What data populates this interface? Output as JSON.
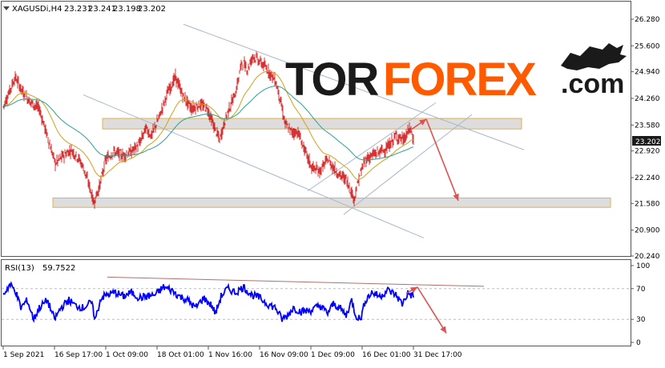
{
  "window": {
    "symbol_header": "XAGUSDi,H4",
    "ohlc": [
      "23.231",
      "23.241",
      "23.198",
      "23.202"
    ],
    "current_price": "23.202"
  },
  "watermark": {
    "part1": "TOR",
    "part2": "FOREX",
    "part3": ".com"
  },
  "colors": {
    "candle": "#cc0000",
    "ema_fast": "#d4a017",
    "ema_slow": "#2aa198",
    "rsi_line": "#0000ff",
    "arrow": "#e05050",
    "channel": "#a8b8c8",
    "zone_fill": "#dddddd",
    "zone_border": "#e8b04a",
    "logo_dark": "#1a1a1a",
    "logo_orange": "#ff5a00"
  },
  "chart_data": [
    {
      "type": "candlestick",
      "symbol": "XAGUSDi",
      "timeframe": "H4",
      "ylim": [
        20.2,
        26.4
      ],
      "y_ticks": [
        "26.280",
        "25.600",
        "24.940",
        "24.260",
        "23.580",
        "22.920",
        "22.240",
        "21.580",
        "20.900",
        "20.240"
      ],
      "y_tick_values": [
        26.28,
        25.6,
        24.94,
        24.26,
        23.58,
        22.92,
        22.24,
        21.58,
        20.9,
        20.24
      ],
      "x_ticks": [
        "1 Sep 2021",
        "16 Sep 17:00",
        "1 Oct 09:00",
        "18 Oct 01:00",
        "1 Nov 16:00",
        "16 Nov 09:00",
        "1 Dec 09:00",
        "16 Dec 01:00",
        "31 Dec 17:00"
      ],
      "x_tick_index": [
        0,
        64,
        128,
        192,
        256,
        320,
        384,
        448,
        512
      ],
      "close_path": [
        [
          0,
          24.05
        ],
        [
          8,
          24.45
        ],
        [
          15,
          24.8
        ],
        [
          25,
          24.4
        ],
        [
          35,
          24.15
        ],
        [
          45,
          24.0
        ],
        [
          55,
          23.3
        ],
        [
          65,
          22.6
        ],
        [
          75,
          22.8
        ],
        [
          85,
          22.95
        ],
        [
          95,
          22.7
        ],
        [
          100,
          22.5
        ],
        [
          108,
          22.0
        ],
        [
          113,
          21.6
        ],
        [
          120,
          22.0
        ],
        [
          128,
          22.7
        ],
        [
          138,
          22.9
        ],
        [
          150,
          22.8
        ],
        [
          160,
          22.9
        ],
        [
          170,
          23.1
        ],
        [
          178,
          23.5
        ],
        [
          185,
          23.3
        ],
        [
          195,
          23.8
        ],
        [
          205,
          24.4
        ],
        [
          215,
          24.8
        ],
        [
          225,
          24.3
        ],
        [
          235,
          24.0
        ],
        [
          245,
          24.1
        ],
        [
          255,
          24.0
        ],
        [
          262,
          23.6
        ],
        [
          270,
          23.2
        ],
        [
          280,
          23.9
        ],
        [
          290,
          24.4
        ],
        [
          298,
          25.2
        ],
        [
          305,
          25.0
        ],
        [
          312,
          25.35
        ],
        [
          320,
          25.2
        ],
        [
          330,
          25.0
        ],
        [
          340,
          24.7
        ],
        [
          345,
          24.3
        ],
        [
          352,
          23.6
        ],
        [
          360,
          23.4
        ],
        [
          368,
          23.4
        ],
        [
          375,
          23.0
        ],
        [
          385,
          22.5
        ],
        [
          395,
          22.4
        ],
        [
          405,
          22.7
        ],
        [
          412,
          22.5
        ],
        [
          420,
          22.3
        ],
        [
          428,
          22.2
        ],
        [
          433,
          21.95
        ],
        [
          438,
          21.7
        ],
        [
          445,
          22.3
        ],
        [
          452,
          22.7
        ],
        [
          460,
          22.8
        ],
        [
          470,
          22.9
        ],
        [
          480,
          23.0
        ],
        [
          490,
          23.3
        ],
        [
          500,
          23.2
        ],
        [
          508,
          23.5
        ],
        [
          512,
          23.2
        ]
      ],
      "last_price": 23.202,
      "support_zone": [
        21.48,
        21.72
      ],
      "resistance_zone": [
        23.48,
        23.75
      ],
      "forecast_arrow": {
        "from": [
          512,
          23.65
        ],
        "to": [
          548,
          21.65
        ]
      },
      "channels": [
        {
          "from": [
            225,
            26.15
          ],
          "to": [
            650,
            22.95
          ]
        },
        {
          "from": [
            100,
            24.35
          ],
          "to": [
            525,
            20.7
          ]
        },
        {
          "from": [
            380,
            21.9
          ],
          "to": [
            540,
            24.15
          ]
        },
        {
          "from": [
            425,
            21.3
          ],
          "to": [
            585,
            23.85
          ]
        }
      ]
    },
    {
      "type": "line",
      "indicator": "RSI(13)",
      "value_label": "59.7522",
      "ylim": [
        0,
        100
      ],
      "y_ticks": [
        "100",
        "70",
        "30",
        "0"
      ],
      "y_tick_values": [
        100,
        70,
        30,
        0
      ],
      "levels": [
        70,
        30
      ],
      "rsi_path": [
        [
          0,
          62
        ],
        [
          8,
          75
        ],
        [
          15,
          68
        ],
        [
          22,
          45
        ],
        [
          30,
          55
        ],
        [
          38,
          30
        ],
        [
          45,
          45
        ],
        [
          55,
          55
        ],
        [
          64,
          30
        ],
        [
          72,
          45
        ],
        [
          82,
          55
        ],
        [
          90,
          48
        ],
        [
          100,
          45
        ],
        [
          110,
          52
        ],
        [
          115,
          30
        ],
        [
          122,
          58
        ],
        [
          130,
          62
        ],
        [
          140,
          65
        ],
        [
          150,
          60
        ],
        [
          160,
          65
        ],
        [
          170,
          58
        ],
        [
          180,
          60
        ],
        [
          190,
          62
        ],
        [
          200,
          72
        ],
        [
          210,
          68
        ],
        [
          220,
          60
        ],
        [
          230,
          55
        ],
        [
          240,
          45
        ],
        [
          250,
          58
        ],
        [
          260,
          48
        ],
        [
          265,
          38
        ],
        [
          272,
          60
        ],
        [
          280,
          70
        ],
        [
          290,
          65
        ],
        [
          300,
          72
        ],
        [
          310,
          62
        ],
        [
          320,
          58
        ],
        [
          330,
          50
        ],
        [
          340,
          45
        ],
        [
          348,
          30
        ],
        [
          355,
          35
        ],
        [
          362,
          45
        ],
        [
          372,
          40
        ],
        [
          385,
          42
        ],
        [
          395,
          48
        ],
        [
          405,
          38
        ],
        [
          412,
          50
        ],
        [
          420,
          45
        ],
        [
          428,
          35
        ],
        [
          435,
          55
        ],
        [
          440,
          35
        ],
        [
          446,
          30
        ],
        [
          452,
          55
        ],
        [
          460,
          65
        ],
        [
          470,
          60
        ],
        [
          480,
          68
        ],
        [
          490,
          62
        ],
        [
          498,
          50
        ],
        [
          505,
          64
        ],
        [
          512,
          60
        ]
      ],
      "trend_line": {
        "from": [
          130,
          85
        ],
        "to": [
          600,
          73
        ]
      },
      "forecast_arrow": {
        "from": [
          515,
          72
        ],
        "to": [
          545,
          12
        ]
      }
    }
  ]
}
